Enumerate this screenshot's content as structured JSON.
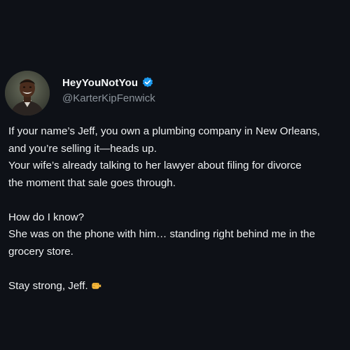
{
  "author": {
    "display_name": "HeyYouNotYou",
    "handle": "@KarterKipFenwick",
    "verified_icon": "verified-badge-icon",
    "verified_color": "#1d9bf0"
  },
  "tweet": {
    "lines": [
      "If your name’s Jeff, you own a plumbing company in New Orleans,",
      "and you’re selling it—heads up.",
      "Your wife’s already talking to her lawyer about filing for divorce",
      "the moment that sale goes through.",
      "How do I know?",
      "She was on the phone with him… standing right behind me in the",
      "grocery store.",
      "Stay strong, Jeff."
    ],
    "emoji": "fist-bump-emoji"
  },
  "colors": {
    "background": "#0e1117",
    "text": "#eef0f1",
    "muted": "#8b939b"
  }
}
